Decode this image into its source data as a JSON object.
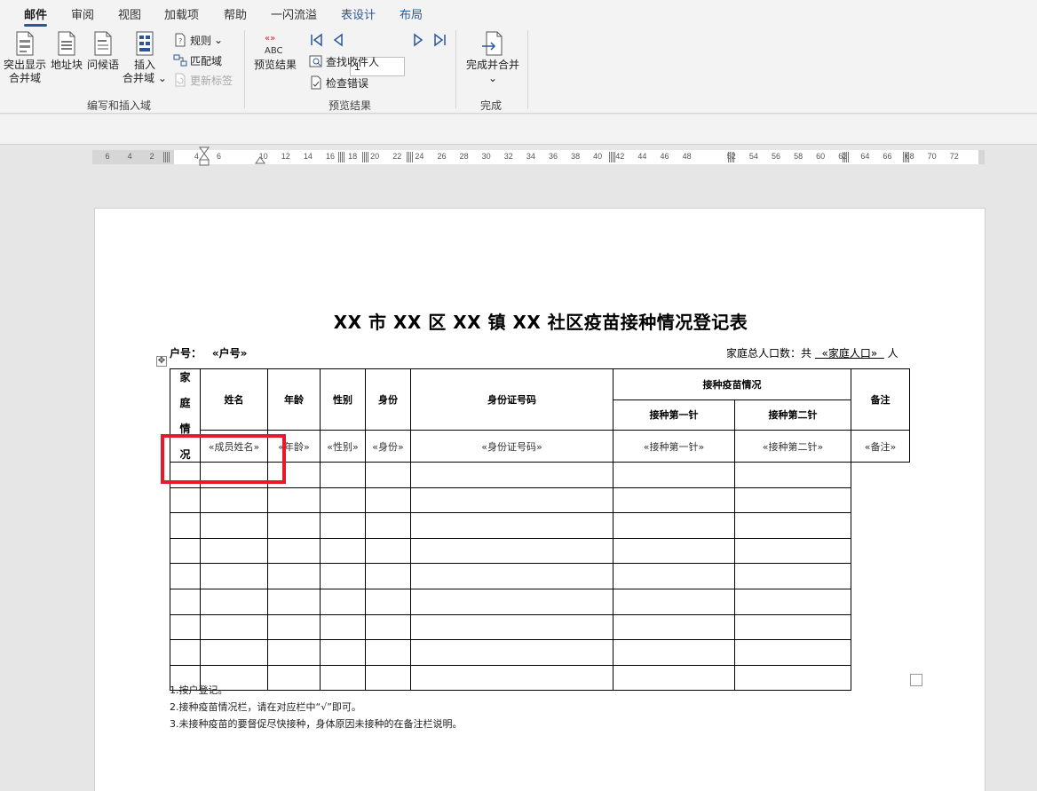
{
  "tabs": [
    {
      "label": "邮件",
      "active": true
    },
    {
      "label": "审阅"
    },
    {
      "label": "视图"
    },
    {
      "label": "加载项"
    },
    {
      "label": "帮助"
    },
    {
      "label": "一闪流溢"
    },
    {
      "label": "表设计",
      "contextual": true
    },
    {
      "label": "布局",
      "contextual": true
    }
  ],
  "ribbon": {
    "write_insert": {
      "highlight_line1": "突出显示",
      "highlight_line2": "合并域",
      "address_block": "地址块",
      "greeting": "问候语",
      "insert_line1": "插入",
      "insert_line2": "合并域",
      "rules": "规则",
      "match_fields": "匹配域",
      "update_labels": "更新标签",
      "group_label": "编写和插入域"
    },
    "preview": {
      "abc": "ABC",
      "preview_results": "预览结果",
      "record_value": "1",
      "find_recipient": "查找收件人",
      "check_errors": "检查错误",
      "group_label": "预览结果"
    },
    "finish": {
      "finish_merge": "完成并合并",
      "group_label": "完成"
    }
  },
  "ruler": {
    "numbers": [
      "6",
      "4",
      "2",
      "",
      "4",
      "6",
      "",
      "10",
      "12",
      "14",
      "16",
      "18",
      "20",
      "22",
      "24",
      "26",
      "28",
      "30",
      "32",
      "34",
      "36",
      "38",
      "40",
      "42",
      "44",
      "46",
      "48",
      "",
      "52",
      "54",
      "56",
      "58",
      "60",
      "62",
      "64",
      "66",
      "68",
      "70",
      "72"
    ]
  },
  "document": {
    "title": "XX 市 XX 区 XX 镇 XX 社区疫苗接种情况登记表",
    "household_label": "户号：",
    "household_field": "«户号»",
    "population_label": "家庭总人口数：共",
    "population_field": "«家庭人口»",
    "population_unit": "人",
    "table": {
      "side_label": [
        "家",
        "庭",
        "情",
        "况"
      ],
      "headers": {
        "name": "姓名",
        "age": "年龄",
        "gender": "性别",
        "identity": "身份",
        "id_number": "身份证号码",
        "vaccination": "接种疫苗情况",
        "dose1": "接种第一针",
        "dose2": "接种第二针",
        "remarks": "备注"
      },
      "merge_row": {
        "name": "«成员姓名»",
        "age": "«年龄»",
        "gender": "«性别»",
        "identity": "«身份»",
        "id_number": "«身份证号码»",
        "dose1": "«接种第一针»",
        "dose2": "«接种第二针»",
        "remarks": "«备注»"
      },
      "empty_rows": 9
    },
    "notes": [
      "1.按户登记。",
      "2.接种疫苗情况栏，请在对应栏中“√”即可。",
      "3.未接种疫苗的要督促尽快接种，身体原因未接种的在备注栏说明。"
    ]
  },
  "colors": {
    "accent": "#2b579a",
    "highlight_box": "#e8192c"
  }
}
